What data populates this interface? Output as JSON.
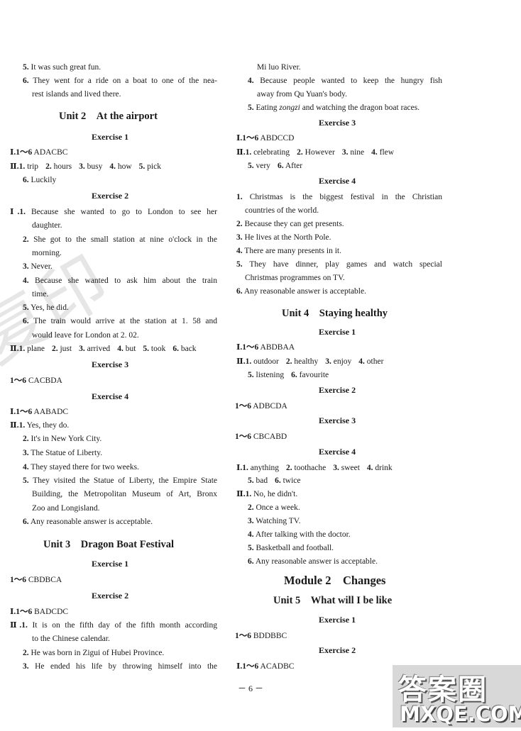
{
  "watermark_text": "复印",
  "left_column": {
    "continued": [
      {
        "num": "5.",
        "text": "It was such great fun."
      },
      {
        "num": "6.",
        "text": "They went for a ride on a boat to one of the nea-",
        "cont": "rest islands and lived there."
      }
    ],
    "unit2": {
      "title": "Unit 2　At the airport",
      "ex1": {
        "title": "Exercise 1",
        "part1": {
          "roman": "Ⅰ.",
          "range": "1～6",
          "answers": "ADACBC"
        },
        "part2": {
          "roman": "Ⅱ.",
          "items": [
            {
              "num": "1.",
              "text": "trip"
            },
            {
              "num": "2.",
              "text": "hours"
            },
            {
              "num": "3.",
              "text": "busy"
            },
            {
              "num": "4.",
              "text": "how"
            },
            {
              "num": "5.",
              "text": "pick"
            },
            {
              "num": "6.",
              "text": "Luckily"
            }
          ]
        }
      },
      "ex2": {
        "title": "Exercise 2",
        "part1": {
          "roman": "Ⅰ.",
          "items": [
            {
              "num": "1.",
              "text": "Because she wanted to go to London to see her",
              "cont": "daughter."
            },
            {
              "num": "2.",
              "text": "She got to the small station at nine o'clock in the",
              "cont": "morning."
            },
            {
              "num": "3.",
              "text": "Never."
            },
            {
              "num": "4.",
              "text": "Because she wanted to ask him about the train",
              "cont": "time."
            },
            {
              "num": "5.",
              "text": "Yes, he did."
            },
            {
              "num": "6.",
              "text": "The train would arrive at the station at 1. 58 and",
              "cont": "would leave for London at 2. 02."
            }
          ]
        },
        "part2": {
          "roman": "Ⅱ.",
          "items": [
            {
              "num": "1.",
              "text": "plane"
            },
            {
              "num": "2.",
              "text": "just"
            },
            {
              "num": "3.",
              "text": "arrived"
            },
            {
              "num": "4.",
              "text": "but"
            },
            {
              "num": "5.",
              "text": "took"
            },
            {
              "num": "6.",
              "text": "back"
            }
          ]
        }
      },
      "ex3": {
        "title": "Exercise 3",
        "range": "1～6",
        "answers": "CACBDA"
      },
      "ex4": {
        "title": "Exercise 4",
        "part1": {
          "roman": "Ⅰ.",
          "range": "1～6",
          "answers": "AABADC"
        },
        "part2": {
          "roman": "Ⅱ.",
          "items": [
            {
              "num": "1.",
              "text": "Yes, they do."
            },
            {
              "num": "2.",
              "text": "It's in New York City."
            },
            {
              "num": "3.",
              "text": "The Statue of Liberty."
            },
            {
              "num": "4.",
              "text": "They stayed there for two weeks."
            },
            {
              "num": "5.",
              "text": "They visited the Statue of Liberty, the Empire State",
              "cont": "Building, the Metropolitan Museum of Art, Bronx",
              "cont2": "Zoo and Longisland."
            },
            {
              "num": "6.",
              "text": "Any reasonable answer is acceptable."
            }
          ]
        }
      }
    },
    "unit3": {
      "title": "Unit 3　Dragon Boat Festival",
      "ex1": {
        "title": "Exercise 1",
        "range": "1～6",
        "answers": "CBDBCA"
      },
      "ex2": {
        "title": "Exercise 2",
        "part1": {
          "roman": "Ⅰ.",
          "range": "1～6",
          "answers": "BADCDC"
        },
        "part2": {
          "roman": "Ⅱ.",
          "items": [
            {
              "num": "1.",
              "text": "It is on the fifth day of the fifth month according",
              "cont": "to the Chinese calendar."
            },
            {
              "num": "2.",
              "text": "He was born in Zigui of Hubei Province."
            },
            {
              "num": "3.",
              "text": "He ended his life by throwing himself into the"
            }
          ]
        }
      }
    }
  },
  "right_column": {
    "continued_line": "Mi luo River.",
    "continued": [
      {
        "num": "4.",
        "text": "Because people wanted to keep the hungry fish",
        "cont": "away from Qu Yuan's body."
      },
      {
        "num": "5.",
        "text_before": "Eating ",
        "italic": "zongzi",
        "text_after": " and watching the dragon boat races."
      }
    ],
    "unit3_ex3": {
      "title": "Exercise 3",
      "part1": {
        "roman": "Ⅰ.",
        "range": "1～6",
        "answers": "ABDCCD"
      },
      "part2": {
        "roman": "Ⅱ.",
        "items": [
          {
            "num": "1.",
            "text": "celebrating"
          },
          {
            "num": "2.",
            "text": "However"
          },
          {
            "num": "3.",
            "text": "nine"
          },
          {
            "num": "4.",
            "text": "flew"
          },
          {
            "num": "5.",
            "text": "very"
          },
          {
            "num": "6.",
            "text": "After"
          }
        ]
      }
    },
    "unit3_ex4": {
      "title": "Exercise 4",
      "items": [
        {
          "num": "1.",
          "text": "Christmas is the biggest festival in the Christian",
          "cont": "countries of the world."
        },
        {
          "num": "2.",
          "text": "Because they can get presents."
        },
        {
          "num": "3.",
          "text": "He lives at the North Pole."
        },
        {
          "num": "4.",
          "text": "There are many presents in it."
        },
        {
          "num": "5.",
          "text": "They have dinner, play games and watch special",
          "cont": "Christmas programmes on TV."
        },
        {
          "num": "6.",
          "text": "Any reasonable answer is acceptable."
        }
      ]
    },
    "unit4": {
      "title": "Unit 4　Staying healthy",
      "ex1": {
        "title": "Exercise 1",
        "part1": {
          "roman": "Ⅰ.",
          "range": "1～6",
          "answers": "ABDBAA"
        },
        "part2": {
          "roman": "Ⅱ.",
          "items": [
            {
              "num": "1.",
              "text": "outdoor"
            },
            {
              "num": "2.",
              "text": "healthy"
            },
            {
              "num": "3.",
              "text": "enjoy"
            },
            {
              "num": "4.",
              "text": "other"
            },
            {
              "num": "5.",
              "text": "listening"
            },
            {
              "num": "6.",
              "text": "favourite"
            }
          ]
        }
      },
      "ex2": {
        "title": "Exercise 2",
        "range": "1～6",
        "answers": "ADBCDA"
      },
      "ex3": {
        "title": "Exercise 3",
        "range": "1～6",
        "answers": "CBCABD"
      },
      "ex4": {
        "title": "Exercise 4",
        "part1": {
          "roman": "Ⅰ.",
          "items": [
            {
              "num": "1.",
              "text": "anything"
            },
            {
              "num": "2.",
              "text": "toothache"
            },
            {
              "num": "3.",
              "text": "sweet"
            },
            {
              "num": "4.",
              "text": "drink"
            },
            {
              "num": "5.",
              "text": "bad"
            },
            {
              "num": "6.",
              "text": "twice"
            }
          ]
        },
        "part2": {
          "roman": "Ⅱ.",
          "items": [
            {
              "num": "1.",
              "text": "No, he didn't."
            },
            {
              "num": "2.",
              "text": "Once a week."
            },
            {
              "num": "3.",
              "text": "Watching TV."
            },
            {
              "num": "4.",
              "text": "After talking with the doctor."
            },
            {
              "num": "5.",
              "text": "Basketball and football."
            },
            {
              "num": "6.",
              "text": "Any reasonable answer is acceptable."
            }
          ]
        }
      }
    },
    "module2": {
      "title": "Module 2　Changes",
      "unit5": {
        "title": "Unit 5　What will I be like",
        "ex1": {
          "title": "Exercise 1",
          "range": "1～6",
          "answers": "BDDBBC"
        },
        "ex2": {
          "title": "Exercise 2",
          "part1": {
            "roman": "Ⅰ.",
            "range": "1～6",
            "answers": "ACADBC"
          }
        }
      }
    }
  },
  "page_number": "－ 6 －",
  "stamp": {
    "chinese": "答案圈",
    "english": "MXQE.COM"
  }
}
